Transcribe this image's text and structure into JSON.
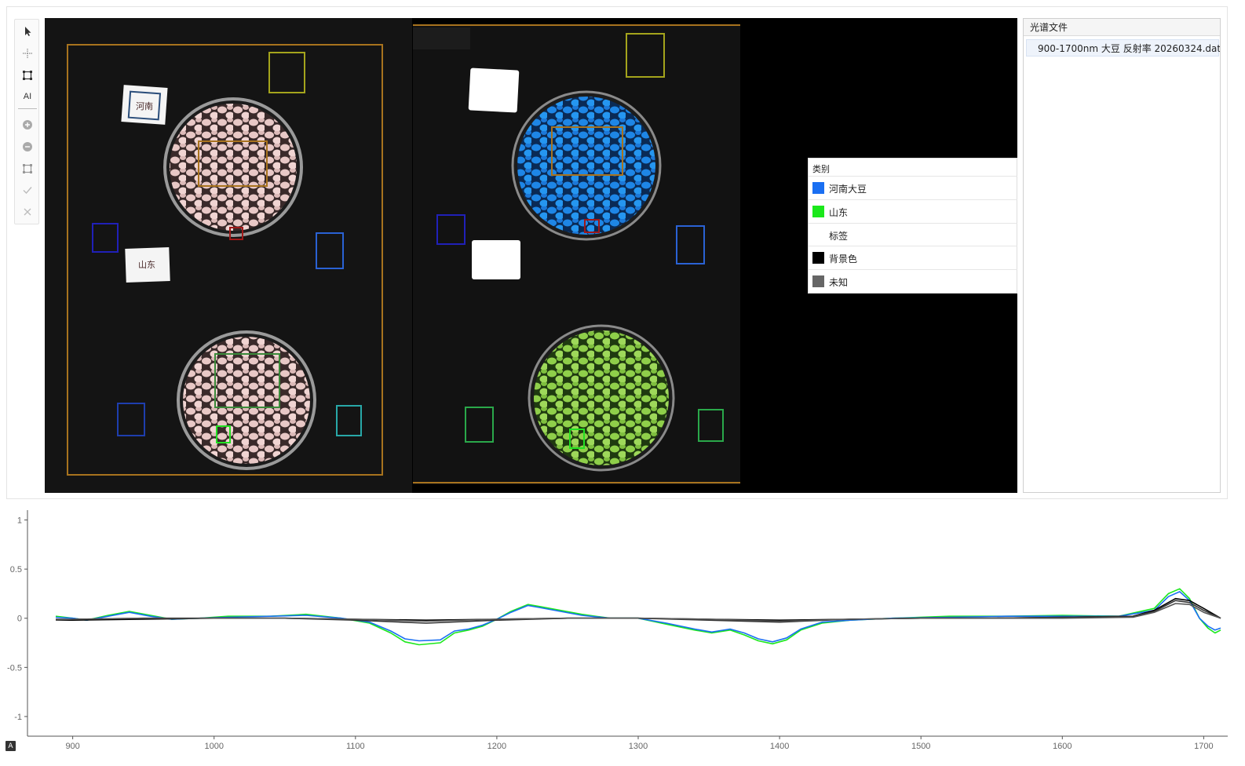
{
  "toolbar": {
    "tools": [
      {
        "icon": "pointer-icon"
      },
      {
        "icon": "crosshair-point-icon"
      },
      {
        "icon": "rectangle-select-icon"
      },
      {
        "icon": "ai-icon",
        "label": "AI"
      },
      {
        "icon": "add-circle-icon"
      },
      {
        "icon": "remove-circle-icon"
      },
      {
        "icon": "roi-rect-icon"
      },
      {
        "icon": "check-icon"
      },
      {
        "icon": "close-icon"
      }
    ]
  },
  "image": {
    "left_labels": [
      "河南",
      "山东"
    ]
  },
  "legend": {
    "title": "类别",
    "items": [
      {
        "label": "河南大豆",
        "color": "#1a6ff2"
      },
      {
        "label": "山东",
        "color": "#1be81b"
      },
      {
        "label": "标签",
        "color": "#ffffff"
      },
      {
        "label": "背景色",
        "color": "#000000"
      },
      {
        "label": "未知",
        "color": "#666666"
      }
    ]
  },
  "file_panel": {
    "title": "光谱文件",
    "files": [
      {
        "name": "900-1700nm 大豆 反射率 20260324.dat",
        "icon": "image-file-icon"
      }
    ]
  },
  "chart_data": {
    "type": "line",
    "title": "",
    "xlabel": "",
    "ylabel": "",
    "xlim": [
      868,
      1717
    ],
    "ylim": [
      -1.2,
      1.1
    ],
    "xticks": [
      900,
      1000,
      1100,
      1200,
      1300,
      1400,
      1500,
      1600,
      1700
    ],
    "yticks": [
      1,
      0.5,
      0,
      -0.5,
      -1
    ],
    "ytick_labels": [
      "1",
      "0.5",
      "0",
      "-0.5",
      "-1"
    ],
    "series": [
      {
        "color": "#1be81b",
        "x": [
          888,
          900,
          910,
          925,
          940,
          955,
          970,
          990,
          1010,
          1040,
          1065,
          1090,
          1110,
          1125,
          1135,
          1145,
          1160,
          1170,
          1180,
          1190,
          1200,
          1210,
          1222,
          1230,
          1245,
          1260,
          1280,
          1300,
          1320,
          1340,
          1352,
          1365,
          1375,
          1385,
          1395,
          1405,
          1415,
          1430,
          1450,
          1480,
          1520,
          1560,
          1600,
          1640,
          1665,
          1675,
          1683,
          1690,
          1697,
          1703,
          1708,
          1712
        ],
        "y": [
          0.02,
          0.0,
          -0.02,
          0.03,
          0.07,
          0.03,
          -0.01,
          0.0,
          0.02,
          0.02,
          0.04,
          0.0,
          -0.05,
          -0.15,
          -0.24,
          -0.27,
          -0.25,
          -0.15,
          -0.12,
          -0.08,
          -0.01,
          0.07,
          0.14,
          0.12,
          0.08,
          0.04,
          0.0,
          0.0,
          -0.06,
          -0.12,
          -0.15,
          -0.12,
          -0.17,
          -0.23,
          -0.26,
          -0.22,
          -0.12,
          -0.05,
          -0.02,
          0.0,
          0.02,
          0.02,
          0.03,
          0.02,
          0.1,
          0.25,
          0.3,
          0.2,
          0.0,
          -0.1,
          -0.15,
          -0.12
        ]
      },
      {
        "color": "#1a6ff2",
        "x": [
          888,
          900,
          910,
          925,
          940,
          955,
          970,
          990,
          1010,
          1040,
          1065,
          1090,
          1110,
          1125,
          1135,
          1145,
          1160,
          1170,
          1180,
          1190,
          1200,
          1210,
          1222,
          1230,
          1245,
          1260,
          1280,
          1300,
          1320,
          1340,
          1352,
          1365,
          1375,
          1385,
          1395,
          1405,
          1415,
          1430,
          1450,
          1480,
          1520,
          1560,
          1600,
          1640,
          1665,
          1675,
          1683,
          1690,
          1697,
          1703,
          1708,
          1712
        ],
        "y": [
          0.01,
          0.0,
          -0.02,
          0.02,
          0.06,
          0.02,
          -0.01,
          0.0,
          0.01,
          0.02,
          0.03,
          0.0,
          -0.04,
          -0.13,
          -0.21,
          -0.23,
          -0.22,
          -0.13,
          -0.11,
          -0.07,
          -0.01,
          0.06,
          0.13,
          0.11,
          0.07,
          0.03,
          0.0,
          0.0,
          -0.05,
          -0.11,
          -0.14,
          -0.11,
          -0.15,
          -0.21,
          -0.24,
          -0.2,
          -0.11,
          -0.04,
          -0.02,
          0.0,
          0.01,
          0.02,
          0.02,
          0.02,
          0.08,
          0.22,
          0.27,
          0.18,
          0.0,
          -0.08,
          -0.12,
          -0.1
        ]
      },
      {
        "color": "#000000",
        "x": [
          888,
          900,
          950,
          1000,
          1050,
          1100,
          1150,
          1200,
          1250,
          1300,
          1350,
          1400,
          1450,
          1500,
          1550,
          1600,
          1650,
          1665,
          1680,
          1690,
          1700,
          1712
        ],
        "y": [
          -0.02,
          -0.02,
          -0.01,
          0.0,
          0.0,
          -0.01,
          -0.02,
          -0.01,
          0.0,
          0.0,
          -0.01,
          -0.02,
          -0.01,
          0.0,
          0.0,
          0.01,
          0.02,
          0.08,
          0.2,
          0.18,
          0.1,
          0.0
        ]
      },
      {
        "color": "#333333",
        "x": [
          888,
          900,
          950,
          1000,
          1050,
          1100,
          1150,
          1200,
          1250,
          1300,
          1350,
          1400,
          1450,
          1500,
          1550,
          1600,
          1650,
          1665,
          1680,
          1690,
          1700,
          1712
        ],
        "y": [
          -0.01,
          -0.01,
          0.0,
          0.0,
          0.0,
          -0.02,
          -0.05,
          -0.02,
          0.0,
          0.0,
          -0.02,
          -0.04,
          -0.01,
          0.0,
          0.0,
          0.01,
          0.02,
          0.07,
          0.18,
          0.16,
          0.08,
          0.0
        ]
      },
      {
        "color": "#555555",
        "x": [
          888,
          900,
          950,
          1000,
          1050,
          1100,
          1150,
          1200,
          1250,
          1300,
          1350,
          1400,
          1450,
          1500,
          1550,
          1600,
          1650,
          1665,
          1680,
          1690,
          1700,
          1712
        ],
        "y": [
          -0.02,
          -0.01,
          0.0,
          0.0,
          0.0,
          -0.01,
          -0.03,
          -0.01,
          0.0,
          0.0,
          -0.01,
          -0.03,
          -0.01,
          0.0,
          0.0,
          0.0,
          0.01,
          0.06,
          0.15,
          0.14,
          0.06,
          0.0
        ]
      }
    ]
  }
}
